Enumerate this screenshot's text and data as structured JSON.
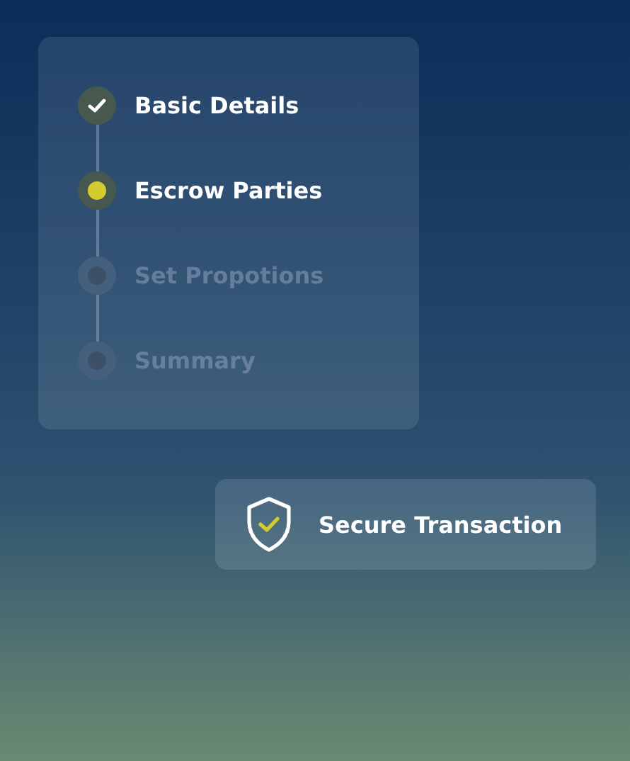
{
  "steps": [
    {
      "label": "Basic Details",
      "kind": "done"
    },
    {
      "label": "Escrow Parties",
      "kind": "current"
    },
    {
      "label": "Set Propotions",
      "kind": "pending"
    },
    {
      "label": "Summary",
      "kind": "pending"
    }
  ],
  "badge": {
    "label": "Secure Transaction"
  }
}
